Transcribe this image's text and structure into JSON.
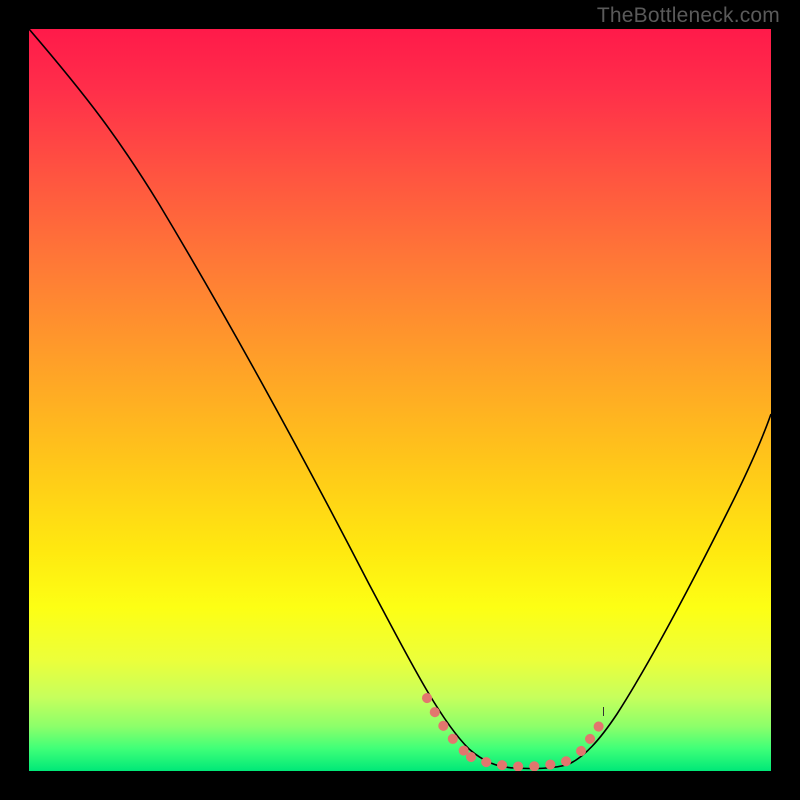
{
  "attribution": "TheBottleneck.com",
  "chart_data": {
    "type": "line",
    "title": "",
    "xlabel": "",
    "ylabel": "",
    "xlim": [
      0,
      100
    ],
    "ylim": [
      0,
      100
    ],
    "series": [
      {
        "name": "curve",
        "x": [
          0,
          5,
          10,
          15,
          20,
          25,
          30,
          35,
          40,
          45,
          50,
          53,
          55,
          58,
          60,
          63,
          66,
          70,
          72,
          75,
          78,
          82,
          86,
          90,
          94,
          98,
          100
        ],
        "values": [
          100,
          92,
          84,
          76,
          68,
          60,
          52,
          44,
          36,
          27,
          18,
          12,
          8,
          4,
          2,
          0.8,
          0.3,
          0.2,
          0.3,
          0.9,
          3,
          8,
          15,
          24,
          34,
          45,
          51
        ]
      }
    ],
    "highlight_range_x": [
      53,
      74
    ],
    "background_gradient": {
      "top": "#ff1a4a",
      "mid": "#ffe810",
      "bottom": "#00e878"
    },
    "colors": {
      "curve": "#000000",
      "dots": "#e2766e",
      "frame": "#000000"
    }
  }
}
